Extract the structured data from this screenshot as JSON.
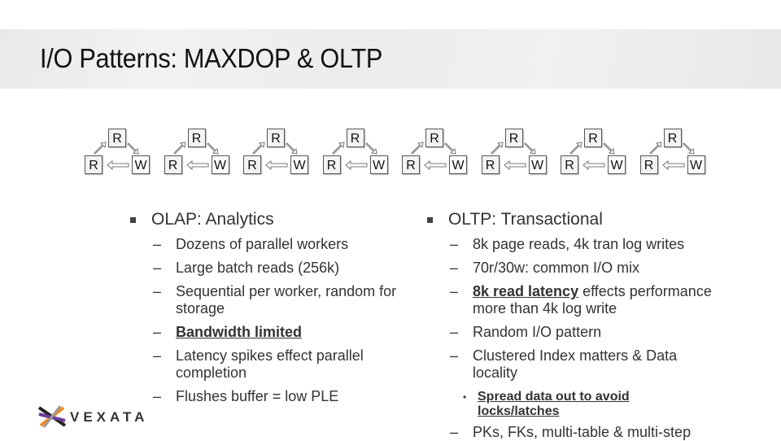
{
  "slide": {
    "title": "I/O Patterns:  MAXDOP & OLTP"
  },
  "diagram": {
    "cycle_count": 8,
    "top_label": "R",
    "left_label": "R",
    "right_label": "W"
  },
  "olap": {
    "heading": "OLAP:  Analytics",
    "items": [
      {
        "text": "Dozens of parallel workers"
      },
      {
        "text": "Large batch reads (256k)"
      },
      {
        "text": "Sequential per worker, random for storage"
      },
      {
        "text": "Bandwidth limited",
        "emphasis": true
      },
      {
        "text": "Latency spikes effect parallel completion"
      },
      {
        "text": "Flushes buffer = low PLE"
      }
    ]
  },
  "oltp": {
    "heading": "OLTP:  Transactional",
    "items": [
      {
        "text": "8k page reads, 4k tran log writes"
      },
      {
        "text": "70r/30w:  common I/O mix"
      },
      {
        "emph": "8k read latency",
        "rest": " effects performance more than 4k log write"
      },
      {
        "text": "Random I/O pattern"
      },
      {
        "text": "Clustered Index matters & Data locality"
      }
    ],
    "sub_item": "Spread data out to avoid locks/latches",
    "cutoff_item": "PKs, FKs, multi-table & multi-step"
  },
  "logo": {
    "text": "VEXATA",
    "colors": {
      "orange": "#f08a24",
      "purple": "#6a3d9a",
      "black": "#222222",
      "gray": "#9a9a9a"
    }
  }
}
